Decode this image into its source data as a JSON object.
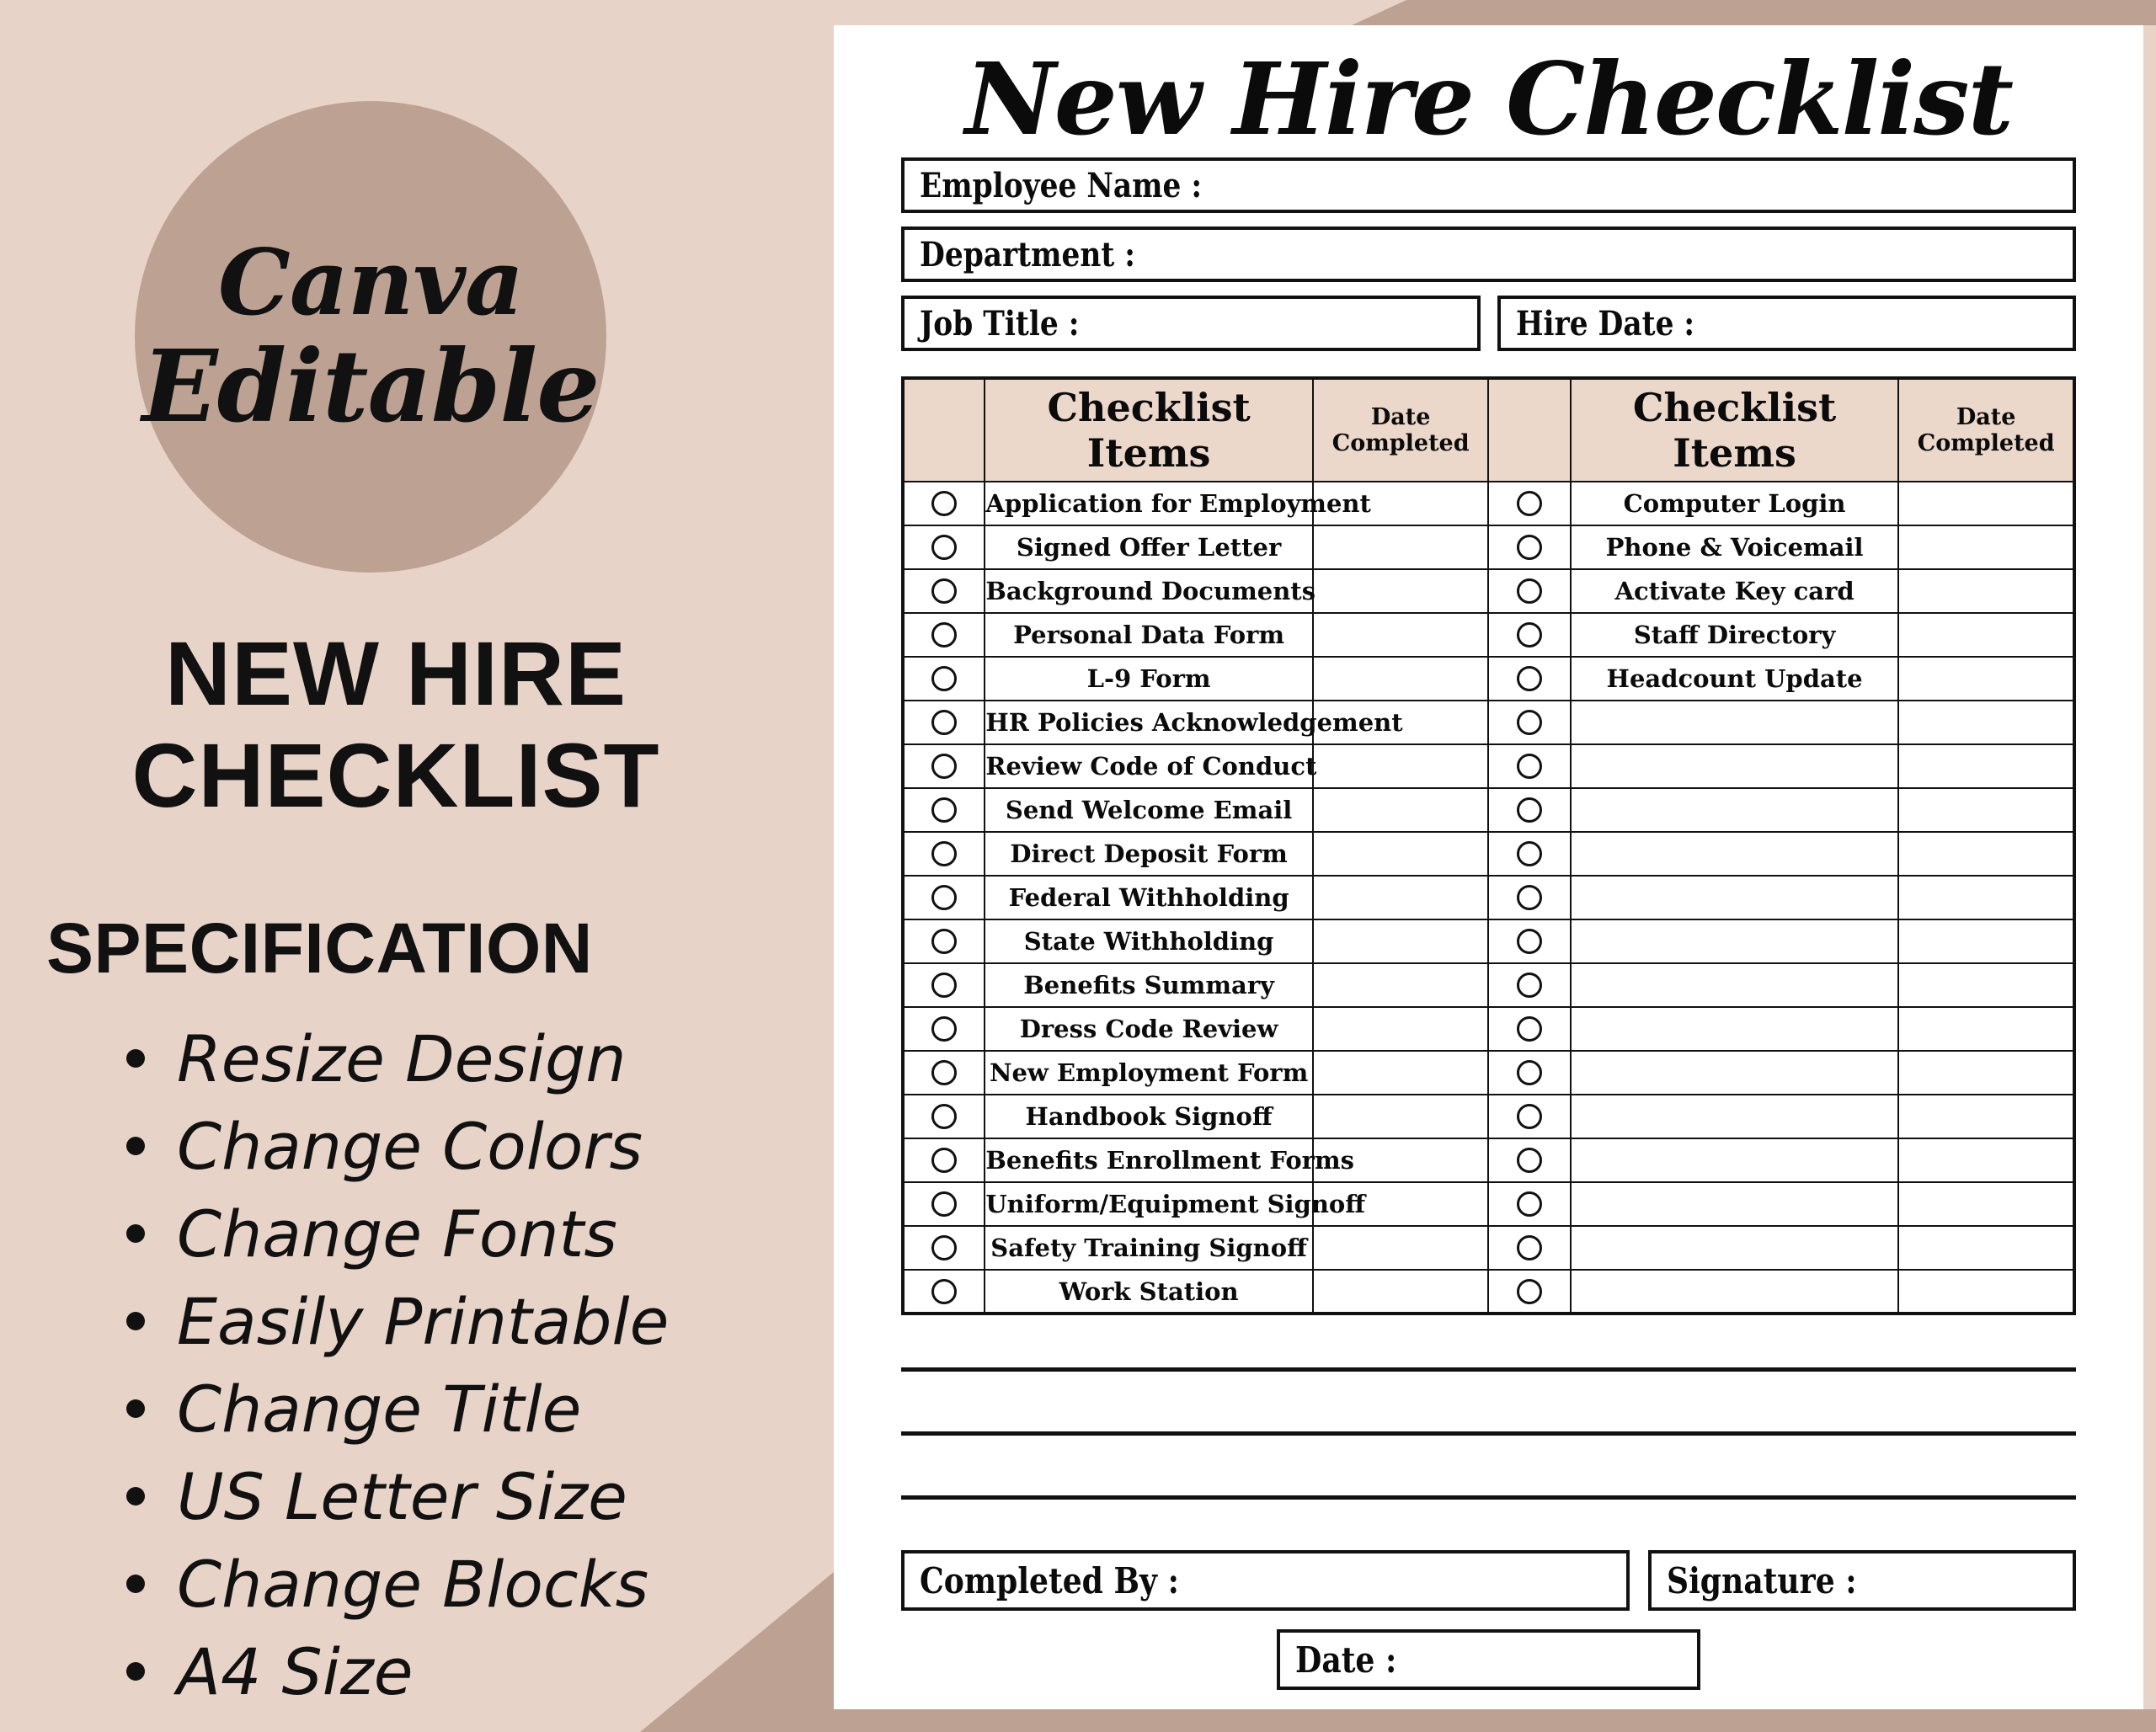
{
  "theme": {
    "background": "#e8d3c8",
    "accent_taupe": "#bda294",
    "table_header_fill": "#ecd7cb",
    "ink": "#111111",
    "sheet": "#ffffff"
  },
  "promo": {
    "badge": {
      "line1": "Canva",
      "line2": "Editable"
    },
    "title_line_1": "NEW HIRE",
    "title_line_2": "CHECKLIST",
    "spec_heading": "SPECIFICATION",
    "spec_items": [
      "Resize Design",
      "Change Colors",
      "Change Fonts",
      "Easily Printable",
      "Change Title",
      "US Letter Size",
      "Change Blocks",
      "A4 Size"
    ]
  },
  "document": {
    "title": "New Hire Checklist",
    "fields": {
      "employee_name": "Employee Name :",
      "department": "Department :",
      "job_title": "Job Title :",
      "hire_date": "Hire Date :"
    },
    "table": {
      "headers": {
        "items_left": "Checklist Items",
        "date_left": "Date\nCompleted",
        "items_right": "Checklist Items",
        "date_right": "Date\nCompleted",
        "date_line_1": "Date",
        "date_line_2": "Completed"
      },
      "rows": [
        {
          "left": "Application for Employment",
          "left_date": "",
          "right": "Computer Login",
          "right_date": ""
        },
        {
          "left": "Signed Offer Letter",
          "left_date": "",
          "right": "Phone & Voicemail",
          "right_date": ""
        },
        {
          "left": "Background Documents",
          "left_date": "",
          "right": "Activate Key card",
          "right_date": ""
        },
        {
          "left": "Personal Data Form",
          "left_date": "",
          "right": "Staff Directory",
          "right_date": ""
        },
        {
          "left": "L-9 Form",
          "left_date": "",
          "right": "Headcount Update",
          "right_date": ""
        },
        {
          "left": "HR Policies Acknowledgement",
          "left_date": "",
          "right": "",
          "right_date": ""
        },
        {
          "left": "Review Code of Conduct",
          "left_date": "",
          "right": "",
          "right_date": ""
        },
        {
          "left": "Send Welcome Email",
          "left_date": "",
          "right": "",
          "right_date": ""
        },
        {
          "left": "Direct Deposit Form",
          "left_date": "",
          "right": "",
          "right_date": ""
        },
        {
          "left": "Federal Withholding",
          "left_date": "",
          "right": "",
          "right_date": ""
        },
        {
          "left": "State Withholding",
          "left_date": "",
          "right": "",
          "right_date": ""
        },
        {
          "left": "Benefits Summary",
          "left_date": "",
          "right": "",
          "right_date": ""
        },
        {
          "left": "Dress Code Review",
          "left_date": "",
          "right": "",
          "right_date": ""
        },
        {
          "left": "New Employment Form",
          "left_date": "",
          "right": "",
          "right_date": ""
        },
        {
          "left": "Handbook Signoff",
          "left_date": "",
          "right": "",
          "right_date": ""
        },
        {
          "left": "Benefits Enrollment Forms",
          "left_date": "",
          "right": "",
          "right_date": ""
        },
        {
          "left": "Uniform/Equipment Signoff",
          "left_date": "",
          "right": "",
          "right_date": ""
        },
        {
          "left": "Safety Training Signoff",
          "left_date": "",
          "right": "",
          "right_date": ""
        },
        {
          "left": "Work Station",
          "left_date": "",
          "right": "",
          "right_date": ""
        }
      ]
    },
    "notes_lines": 3,
    "footer": {
      "completed_by": "Completed By :",
      "signature": "Signature :",
      "date": "Date :"
    }
  }
}
